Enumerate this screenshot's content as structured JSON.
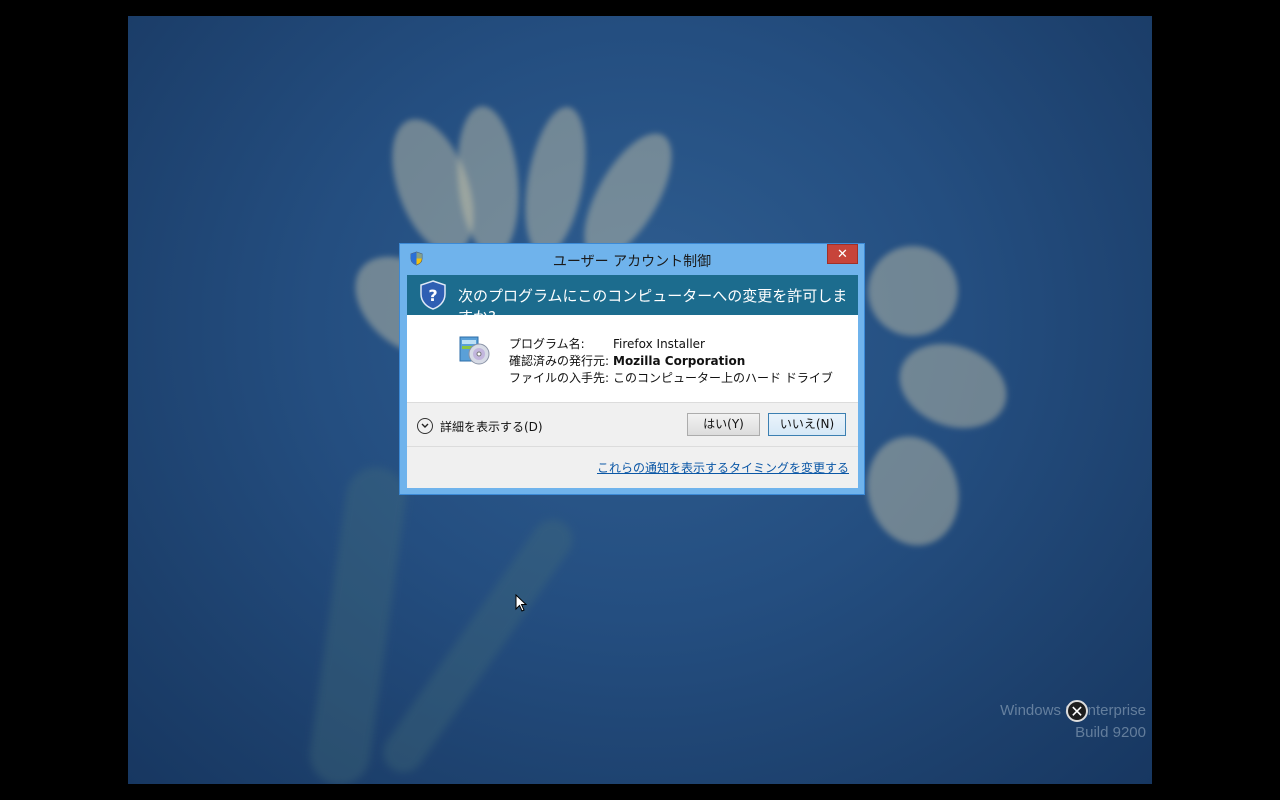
{
  "desktop": {
    "watermark": {
      "line1": "Windows 8 Enterprise",
      "line2": "Build 9200"
    }
  },
  "dialog": {
    "title": "ユーザー アカウント制御",
    "close_label": "✕",
    "question": "次のプログラムにこのコンピューターへの変更を許可しますか?",
    "info": {
      "program_name_label": "プログラム名:",
      "program_name_value": "Firefox Installer",
      "publisher_label": "確認済みの発行元:",
      "publisher_value": "Mozilla Corporation",
      "origin_label": "ファイルの入手先:",
      "origin_value": "このコンピューター上のハード ドライブ"
    },
    "details_label": "詳細を表示する(D)",
    "yes_label": "はい(Y)",
    "no_label": "いいえ(N)",
    "footer_link": "これらの通知を表示するタイミングを変更する"
  },
  "icons": {
    "shield": "uac-shield-icon",
    "question_shield": "question-shield-icon",
    "program": "installer-cd-icon",
    "chevron": "chevron-down-icon",
    "cursor": "mouse-cursor-icon",
    "overlay_close": "close-circle-icon"
  },
  "colors": {
    "titlebar": "#6fb3ec",
    "banner": "#1c6c8e",
    "close_button": "#c7443a",
    "link": "#0b57a6"
  }
}
